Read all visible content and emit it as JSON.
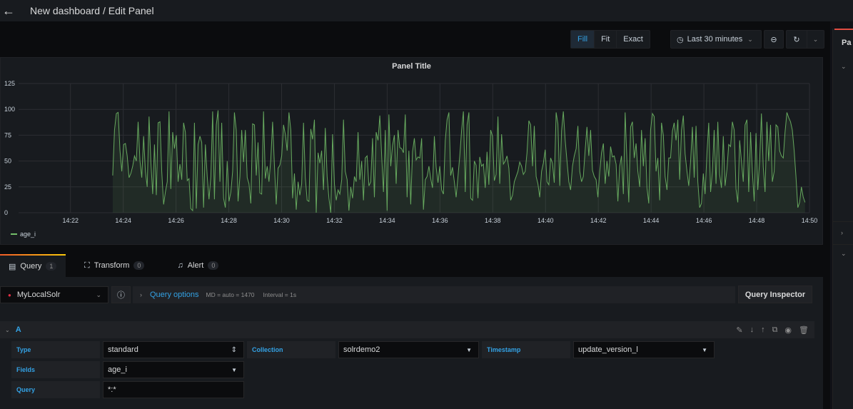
{
  "header": {
    "back_icon": "arrow-left-icon",
    "title": "New dashboard / Edit Panel"
  },
  "toolbar": {
    "fill": "Fill",
    "fit": "Fit",
    "exact": "Exact",
    "time_range": "Last 30 minutes",
    "clock_icon": "clock-icon",
    "zoom_out_icon": "zoom-out-icon",
    "refresh_icon": "refresh-icon"
  },
  "right_pane": {
    "tab_label": "Pa"
  },
  "panel": {
    "title": "Panel Title",
    "legend": "age_i"
  },
  "colors": {
    "series": "#73bf69",
    "accent": "#33a2e5",
    "error": "#e02f44"
  },
  "tabs": [
    {
      "label": "Query",
      "count": "1",
      "icon": "database-icon"
    },
    {
      "label": "Transform",
      "count": "0",
      "icon": "transform-icon"
    },
    {
      "label": "Alert",
      "count": "0",
      "icon": "bell-icon"
    }
  ],
  "query": {
    "datasource": "MyLocalSolr",
    "options_label": "Query options",
    "md": "MD = auto = 1470",
    "interval": "Interval = 1s",
    "inspector": "Query Inspector",
    "ref_id": "A",
    "fields": {
      "type_label": "Type",
      "type_value": "standard",
      "collection_label": "Collection",
      "collection_value": "solrdemo2",
      "timestamp_label": "Timestamp",
      "timestamp_value": "update_version_l",
      "fields_label": "Fields",
      "fields_value": "age_i",
      "query_label": "Query",
      "query_value": "*:*"
    }
  },
  "chart_data": {
    "type": "area",
    "title": "Panel Title",
    "xlabel": "",
    "ylabel": "",
    "x_range": [
      "14:20:02",
      "14:50:00"
    ],
    "ylim": [
      0,
      125
    ],
    "y_ticks": [
      0,
      25,
      50,
      75,
      100,
      125
    ],
    "x_ticks": [
      "14:22",
      "14:24",
      "14:26",
      "14:28",
      "14:30",
      "14:32",
      "14:34",
      "14:36",
      "14:38",
      "14:40",
      "14:42",
      "14:44",
      "14:46",
      "14:48",
      "14:50"
    ],
    "grid": true,
    "legend": "bottom-left",
    "series": [
      {
        "name": "age_i",
        "start": "14:23:36",
        "step_seconds": 5,
        "values": [
          36,
          80,
          96,
          97,
          60,
          40,
          66,
          67,
          55,
          34,
          38,
          45,
          55,
          50,
          88,
          50,
          34,
          74,
          40,
          25,
          93,
          50,
          18,
          66,
          17,
          87,
          88,
          40,
          8,
          20,
          30,
          98,
          23,
          78,
          62,
          75,
          30,
          47,
          32,
          87,
          78,
          31,
          33,
          4,
          2,
          87,
          4,
          66,
          74,
          68,
          5,
          66,
          35,
          13,
          35,
          98,
          13,
          85,
          99,
          30,
          87,
          14,
          5,
          50,
          11,
          20,
          40,
          97,
          80,
          11,
          35,
          80,
          49,
          80,
          34,
          28,
          9,
          86,
          85,
          36,
          68,
          19,
          18,
          98,
          33,
          45,
          30,
          52,
          88,
          45,
          8,
          43,
          46,
          55,
          85,
          76,
          60,
          97,
          80,
          14,
          38,
          3,
          30,
          17,
          28,
          87,
          34,
          12,
          11,
          81,
          71,
          90,
          0,
          58,
          48,
          60,
          22,
          82,
          35,
          14,
          0,
          76,
          28,
          12,
          22,
          18,
          32,
          90,
          40,
          32,
          2,
          25,
          14,
          35,
          30,
          78,
          32,
          50,
          12,
          53,
          55,
          26,
          30,
          72,
          15,
          78,
          70,
          94,
          55,
          20,
          80,
          2,
          95,
          45,
          65,
          75,
          28,
          80,
          63,
          62,
          58,
          95,
          15,
          60,
          8,
          59,
          72,
          51,
          54,
          53,
          72,
          3,
          32,
          35,
          45,
          33,
          24,
          74,
          44,
          29,
          45,
          22,
          18,
          70,
          90,
          97,
          36,
          44,
          30,
          15,
          35,
          55,
          80,
          98,
          20,
          85,
          97,
          14,
          12,
          50,
          46,
          14,
          54,
          45,
          47,
          24,
          59,
          27,
          80,
          74,
          31,
          37,
          93,
          28,
          76,
          47,
          50,
          55,
          43,
          12,
          17,
          30,
          35,
          40,
          49,
          45,
          37,
          40,
          58,
          89,
          85,
          45,
          84,
          35,
          28,
          15,
          40,
          48,
          61,
          30,
          27,
          53,
          48,
          29,
          97,
          86,
          26,
          79,
          98,
          70,
          50,
          30,
          22,
          45,
          55,
          62,
          84,
          40,
          30,
          35,
          61,
          83,
          55,
          80,
          41,
          35,
          32,
          15,
          40,
          58,
          67,
          28,
          50,
          35,
          64,
          54,
          55,
          47,
          11,
          45,
          55,
          18,
          97,
          50,
          10,
          83,
          88,
          53,
          67,
          40,
          25,
          80,
          45,
          72,
          24,
          9,
          80,
          96,
          93,
          40,
          53,
          12,
          87,
          75,
          35,
          22,
          53,
          53,
          79,
          87,
          70,
          90,
          32,
          80,
          94,
          57,
          40,
          26,
          50,
          83,
          34,
          84,
          30,
          5,
          9,
          38,
          18,
          58,
          87,
          20,
          40,
          80,
          28,
          88,
          37,
          24,
          74,
          26,
          42,
          66,
          64,
          88,
          80,
          23,
          10,
          70,
          50,
          30,
          85,
          90,
          20,
          78,
          40,
          11,
          77,
          22,
          50,
          96,
          44,
          20,
          88,
          50,
          85,
          30,
          40,
          85,
          83,
          60,
          55,
          53,
          78,
          97,
          92,
          88,
          80,
          60,
          35,
          5,
          10,
          25,
          15,
          10
        ]
      }
    ]
  }
}
